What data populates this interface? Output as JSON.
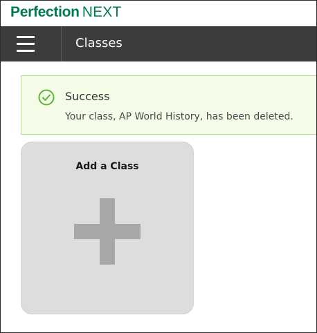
{
  "brand": {
    "name": "Perfection",
    "suffix": "NEXT",
    "color": "#007a4d"
  },
  "header": {
    "menu_icon": "hamburger-menu-icon",
    "title": "Classes",
    "background": "#3c3c3c"
  },
  "alert": {
    "icon": "check-circle-icon",
    "title": "Success",
    "message": "Your class, AP World History, has been deleted.",
    "accent": "#5cb82e"
  },
  "add_card": {
    "title": "Add a Class",
    "icon": "plus-icon"
  }
}
